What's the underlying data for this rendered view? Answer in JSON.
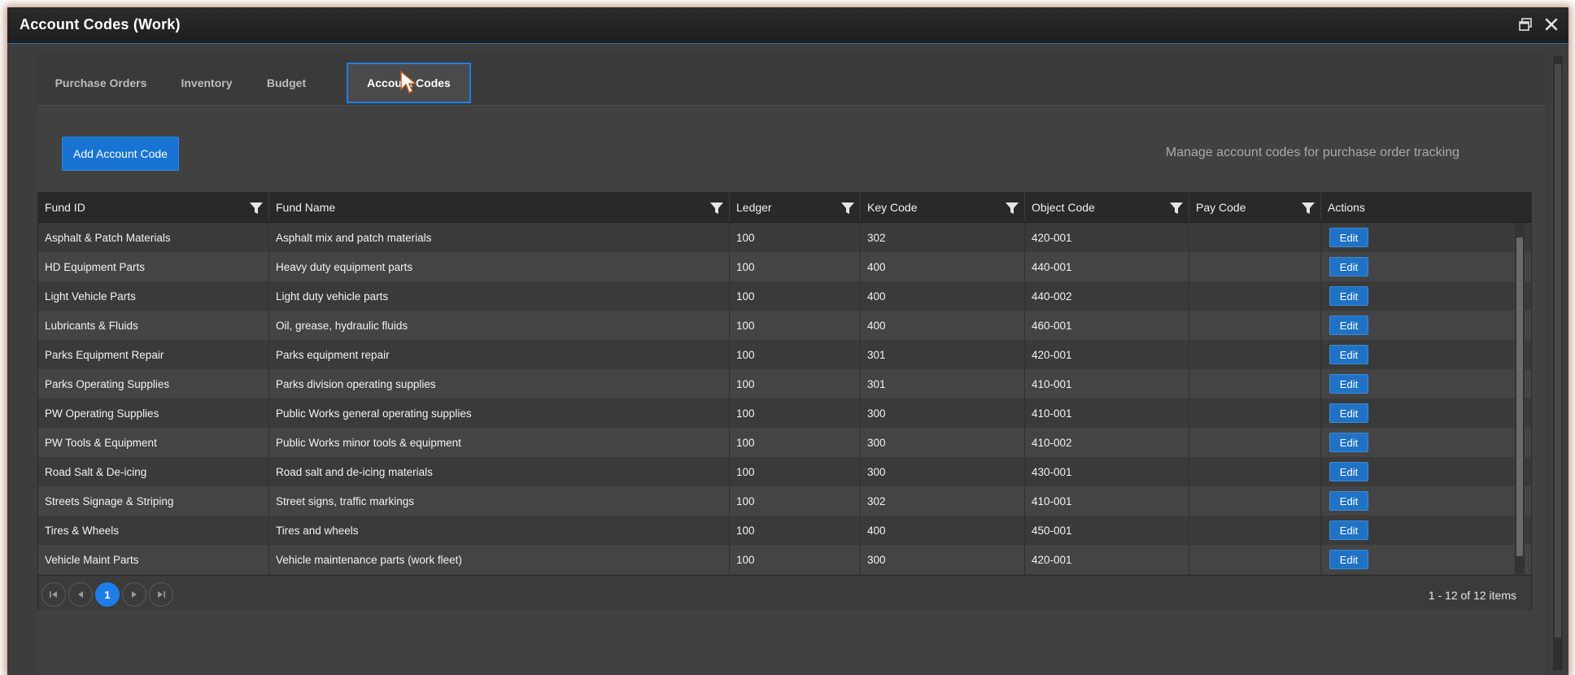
{
  "window": {
    "title": "Account Codes (Work)",
    "restore_icon": "restore-window-icon",
    "close_icon": "close-icon"
  },
  "tabs": [
    {
      "label": "Purchase Orders",
      "active": false
    },
    {
      "label": "Inventory",
      "active": false
    },
    {
      "label": "Budget",
      "active": false
    },
    {
      "label": "Account Codes",
      "active": true
    }
  ],
  "toolbar": {
    "add_label": "Add Account Code",
    "description": "Manage account codes for purchase order tracking"
  },
  "grid": {
    "columns": [
      "Fund ID",
      "Fund Name",
      "Ledger",
      "Key Code",
      "Object Code",
      "Pay Code",
      "Actions"
    ],
    "edit_label": "Edit",
    "rows": [
      {
        "fund_id": "Asphalt & Patch Materials",
        "fund_name": "Asphalt mix and patch materials",
        "ledger": "100",
        "key_code": "302",
        "object_code": "420-001",
        "pay_code": ""
      },
      {
        "fund_id": "HD Equipment Parts",
        "fund_name": "Heavy duty equipment parts",
        "ledger": "100",
        "key_code": "400",
        "object_code": "440-001",
        "pay_code": ""
      },
      {
        "fund_id": "Light Vehicle Parts",
        "fund_name": "Light duty vehicle parts",
        "ledger": "100",
        "key_code": "400",
        "object_code": "440-002",
        "pay_code": ""
      },
      {
        "fund_id": "Lubricants & Fluids",
        "fund_name": "Oil, grease, hydraulic fluids",
        "ledger": "100",
        "key_code": "400",
        "object_code": "460-001",
        "pay_code": ""
      },
      {
        "fund_id": "Parks Equipment Repair",
        "fund_name": "Parks equipment repair",
        "ledger": "100",
        "key_code": "301",
        "object_code": "420-001",
        "pay_code": ""
      },
      {
        "fund_id": "Parks Operating Supplies",
        "fund_name": "Parks division operating supplies",
        "ledger": "100",
        "key_code": "301",
        "object_code": "410-001",
        "pay_code": ""
      },
      {
        "fund_id": "PW Operating Supplies",
        "fund_name": "Public Works general operating supplies",
        "ledger": "100",
        "key_code": "300",
        "object_code": "410-001",
        "pay_code": ""
      },
      {
        "fund_id": "PW Tools & Equipment",
        "fund_name": "Public Works minor tools & equipment",
        "ledger": "100",
        "key_code": "300",
        "object_code": "410-002",
        "pay_code": ""
      },
      {
        "fund_id": "Road Salt & De-icing",
        "fund_name": "Road salt and de-icing materials",
        "ledger": "100",
        "key_code": "300",
        "object_code": "430-001",
        "pay_code": ""
      },
      {
        "fund_id": "Streets Signage & Striping",
        "fund_name": "Street signs, traffic markings",
        "ledger": "100",
        "key_code": "302",
        "object_code": "410-001",
        "pay_code": ""
      },
      {
        "fund_id": "Tires & Wheels",
        "fund_name": "Tires and wheels",
        "ledger": "100",
        "key_code": "400",
        "object_code": "450-001",
        "pay_code": ""
      },
      {
        "fund_id": "Vehicle Maint Parts",
        "fund_name": "Vehicle maintenance parts (work fleet)",
        "ledger": "100",
        "key_code": "300",
        "object_code": "420-001",
        "pay_code": ""
      }
    ]
  },
  "pager": {
    "current_page": "1",
    "info": "1 - 12 of 12 items"
  },
  "colors": {
    "accent": "#1e7ee8",
    "button": "#1873d3"
  }
}
